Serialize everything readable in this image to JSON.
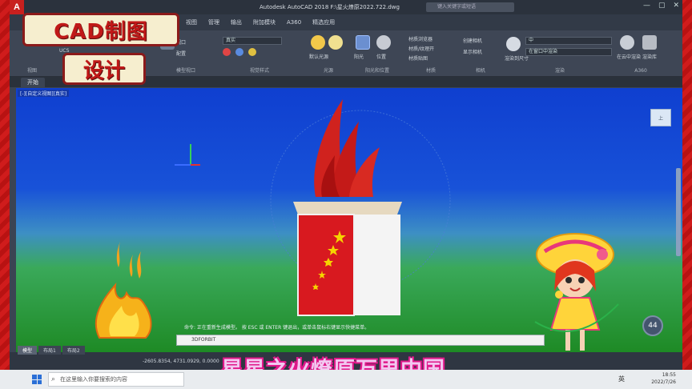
{
  "app": {
    "logo_letter": "A",
    "title": "Autodesk AutoCAD 2018    F:\\星火燎原2022.722.dwg",
    "search_placeholder": "键入关键字或短语",
    "window_controls": [
      "—",
      "▢",
      "✕"
    ]
  },
  "menubar": {
    "items": [
      "视图",
      "管理",
      "输出",
      "附加模块",
      "A360",
      "精选应用"
    ]
  },
  "ribbon": {
    "groups": [
      {
        "label": "视图"
      },
      {
        "label": "坐标",
        "items": [
          "世界",
          "UCS"
        ]
      },
      {
        "label": "模型视口",
        "items": [
          "视口",
          "配置"
        ]
      },
      {
        "label": "视觉样式",
        "dropdown": "真实"
      },
      {
        "label": "光源",
        "items": [
          "默认光源",
          "阳光状态"
        ]
      },
      {
        "label": "阳光和位置",
        "items": [
          "阳光",
          "位置"
        ]
      },
      {
        "label": "材质",
        "items": [
          "材质浏览器",
          "材质/纹理开",
          "材质贴图"
        ]
      },
      {
        "label": "相机",
        "items": [
          "创建相机",
          "显示相机"
        ]
      },
      {
        "label": "渲染",
        "items": [
          "渲染到尺寸"
        ],
        "dropdown": "中",
        "dropdown2": "在窗口中渲染"
      },
      {
        "label": "A360",
        "items": [
          "在云中渲染",
          "渲染库"
        ]
      }
    ]
  },
  "doc_tabs": {
    "active": "开始",
    "file": "星火燎原2022.722*"
  },
  "viewport": {
    "label": "[-][自定义视图][真实]",
    "viewcube_label": "上",
    "command_history": "命令: 正在重新生成模型。  按 ESC 或 ENTER 键退出，或单击鼠标右键显示快捷菜单。",
    "command_input": "3DFORBIT",
    "speed_badge": "44"
  },
  "layout_tabs": [
    "模型",
    "布局1",
    "布局2"
  ],
  "status": {
    "coords": "-2605.8354, 4731.0929, 0.0000"
  },
  "overlay": {
    "badge_top": "CAD制图",
    "badge_bottom": "设计",
    "subtitle": "星星之火燎原万里中国"
  },
  "taskbar": {
    "search_placeholder": "在这里输入你要搜索的内容",
    "ime": "英",
    "time": "18:55",
    "date": "2022/7/26"
  },
  "colors": {
    "accent_red": "#c81818",
    "sky_blue": "#1852d8",
    "ground_green": "#1e8a25",
    "flag_red": "#d8191f",
    "star_yellow": "#f5d400"
  }
}
